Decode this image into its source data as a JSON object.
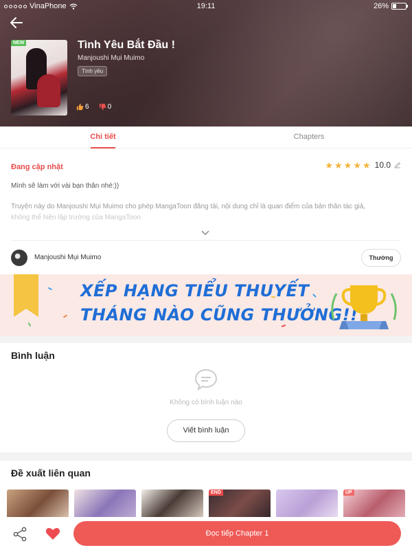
{
  "status_bar": {
    "carrier": "VinaPhone",
    "time": "19:11",
    "battery": "26%"
  },
  "book": {
    "title": "Tình Yêu Bắt Đầu !",
    "author": "Manjoushi Mụi Muimo",
    "genre_tag": "Tình yêu",
    "cover_badge": "NEW",
    "likes": "6",
    "dislikes": "0"
  },
  "tabs": [
    {
      "label": "Chi tiết",
      "active": true
    },
    {
      "label": "Chapters",
      "active": false
    }
  ],
  "details": {
    "status": "Đang cập nhật",
    "rating": "10.0",
    "stars": 5,
    "description_1": "Mình sẽ làm với vài bạn thân nhé:))",
    "description_2": "Truyện này do Manjoushi Mụi Muimo cho phép MangaToon đăng tải, nội dung chỉ là quan điểm của bản thân tác giả,",
    "description_3": "không thể hiện lập trường của MangaToon"
  },
  "author_row": {
    "name": "Manjoushi Mụi Muimo",
    "level_button": "Thường"
  },
  "banner": {
    "line1": "XẾP HẠNG TIỂU THUYẾT",
    "line2": "THÁNG NÀO CŨNG THƯỞNG!!"
  },
  "comments": {
    "title": "Bình luận",
    "empty_text": "Không có bình luận nào",
    "write_button": "Viết bình luận"
  },
  "recommendations": {
    "title": "Đề xuất liên quan",
    "cards": [
      {
        "tag": ""
      },
      {
        "tag": ""
      },
      {
        "tag": ""
      },
      {
        "tag": "END"
      },
      {
        "tag": ""
      },
      {
        "tag": "UP"
      }
    ]
  },
  "bottom_bar": {
    "read_button": "Đọc tiếp Chapter 1"
  },
  "colors": {
    "accent": "#e94b4b",
    "read_button": "#ef5a57",
    "star": "#f6b43a",
    "banner_text": "#1f6ed6"
  }
}
